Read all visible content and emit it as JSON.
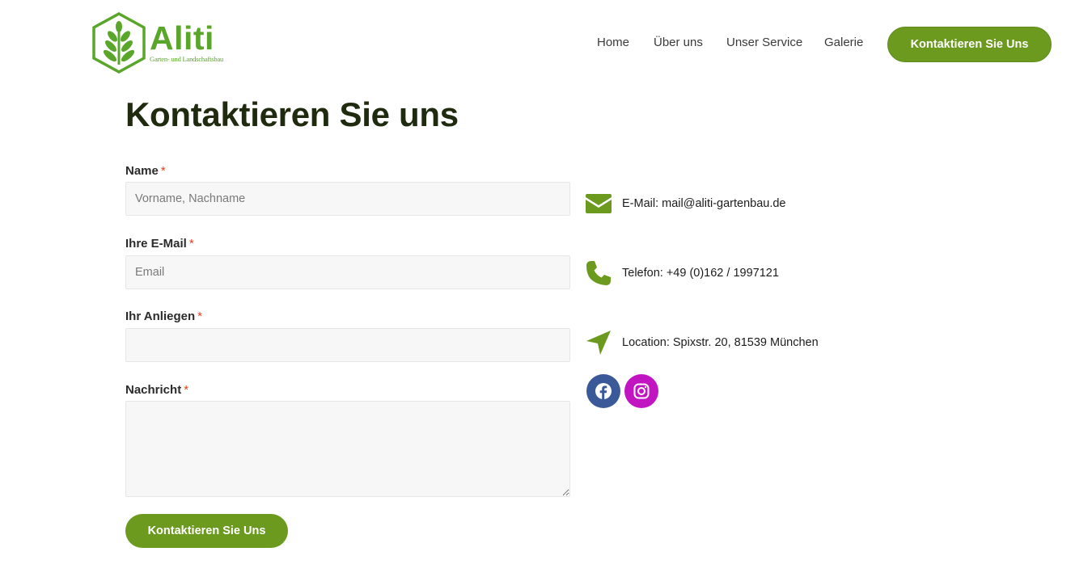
{
  "brand": {
    "name": "Aliti",
    "tagline": "Garten- und Landschaftsbau",
    "color": "#5aa62a"
  },
  "nav": {
    "items": [
      {
        "label": "Home"
      },
      {
        "label": "Über uns"
      },
      {
        "label": "Unser Service"
      },
      {
        "label": "Galerie"
      }
    ],
    "cta_label": "Kontaktieren Sie Uns"
  },
  "page": {
    "title": "Kontaktieren Sie uns"
  },
  "form": {
    "required_mark": "*",
    "fields": [
      {
        "label": "Name",
        "placeholder": "Vorname, Nachname",
        "value": ""
      },
      {
        "label": "Ihre E-Mail",
        "placeholder": "Email",
        "value": ""
      },
      {
        "label": "Ihr Anliegen",
        "placeholder": "",
        "value": ""
      },
      {
        "label": "Nachricht",
        "placeholder": "",
        "value": ""
      }
    ],
    "submit_label": "Kontaktieren Sie Uns"
  },
  "contact": {
    "email": {
      "text": "E-Mail: mail@aliti-gartenbau.de",
      "icon": "envelope-icon"
    },
    "phone": {
      "text": "Telefon: +49 (0)162 / 1997121",
      "icon": "phone-icon"
    },
    "location": {
      "text": "Location: Spixstr. 20, 81539 München",
      "icon": "location-arrow-icon"
    },
    "social": [
      {
        "name": "facebook",
        "icon": "facebook-icon",
        "color": "#3b5998"
      },
      {
        "name": "instagram",
        "icon": "instagram-icon",
        "color": "#c115c1"
      }
    ]
  },
  "colors": {
    "accent": "#6c9a1f",
    "icon_green": "#6c9a1f",
    "required": "#e2401c"
  }
}
